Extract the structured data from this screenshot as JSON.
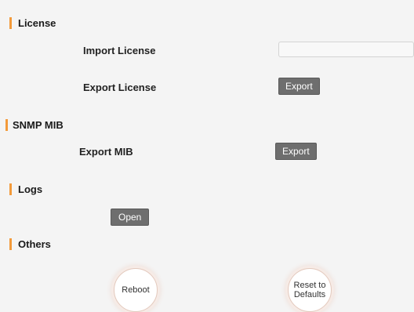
{
  "sections": {
    "license": {
      "title": "License",
      "import_label": "Import License",
      "import_value": "",
      "export_label": "Export License",
      "export_button": "Export"
    },
    "snmp": {
      "title": "SNMP MIB",
      "export_label": "Export MIB",
      "export_button": "Export"
    },
    "logs": {
      "title": "Logs",
      "open_button": "Open"
    },
    "others": {
      "title": "Others",
      "reboot_button": "Reboot",
      "reset_button_line1": "Reset to",
      "reset_button_line2": "Defaults"
    }
  },
  "colors": {
    "accent": "#f39a3a",
    "button_bg": "#6e6e6e",
    "page_bg": "#f4f4f4"
  }
}
